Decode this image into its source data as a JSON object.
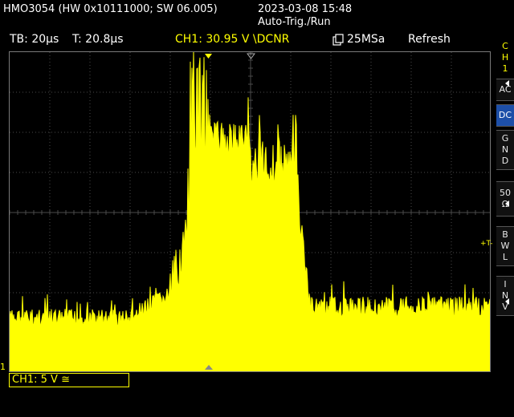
{
  "header": {
    "model": "HMO3054 (HW 0x10111000; SW 06.005)",
    "datetime": "2023-03-08 15:48",
    "mode": "Auto-Trig./Run"
  },
  "info_bar": {
    "timebase": "TB: 20µs",
    "trigger_time": "T: 20.8µs",
    "ch1_trigger": "CH1: 30.95 V \\DCNR",
    "sample_rate": "25MSa",
    "acq_mode": "Refresh"
  },
  "side_menu": {
    "channel": [
      "C",
      "H",
      "1"
    ],
    "items": [
      {
        "label": [
          "AC"
        ],
        "active": false
      },
      {
        "label": [
          "DC"
        ],
        "active": true
      },
      {
        "label": [
          "G",
          "N",
          "D"
        ],
        "active": false
      },
      {
        "label": [
          "50",
          "Ω"
        ],
        "active": false
      },
      {
        "label": [
          "B",
          "W",
          "L"
        ],
        "active": false
      },
      {
        "label": [
          "I",
          "N",
          "V"
        ],
        "active": false
      }
    ]
  },
  "channel_box": "CH1: 5 V ≅",
  "markers": {
    "trigger_level": "+T-",
    "ground": "1"
  },
  "colors": {
    "trace": "#ffff00",
    "grid": "#4a4a4a",
    "active_button": "#1d4fa8"
  }
}
